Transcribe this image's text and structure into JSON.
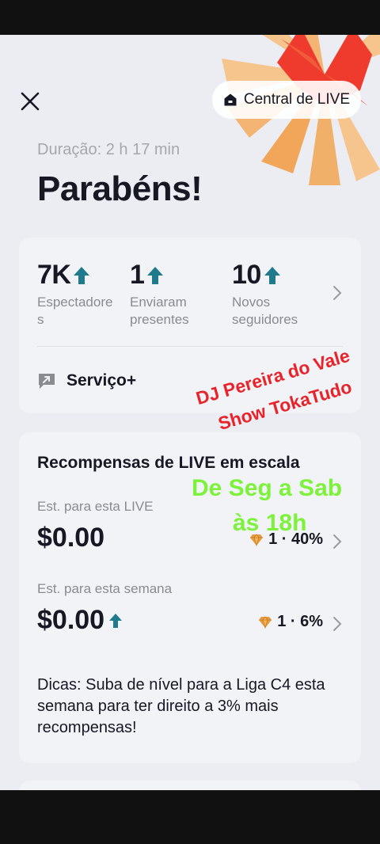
{
  "header": {
    "close_icon": "close-icon",
    "live_center_label": "Central de LIVE",
    "live_center_icon": "home-icon"
  },
  "summary": {
    "duration": "Duração: 2 h 17 min",
    "title": "Parabéns!"
  },
  "stats": [
    {
      "value": "7K",
      "label_line1": "Espectadore",
      "label_line2": "s",
      "trend": "up"
    },
    {
      "value": "1",
      "label_line1": "Enviaram",
      "label_line2": "presentes",
      "trend": "up"
    },
    {
      "value": "10",
      "label_line1": "Novos",
      "label_line2": "seguidores",
      "trend": "up"
    }
  ],
  "service": {
    "label": "Serviço+",
    "icon": "chat-arrow-icon"
  },
  "rewards": {
    "title": "Recompensas de LIVE em escala",
    "this_live": {
      "label": "Est. para esta LIVE",
      "amount": "$0.00",
      "stat": "1 · 40%"
    },
    "this_week": {
      "label": "Est. para esta semana",
      "amount": "$0.00",
      "stat": "1 · 6%"
    },
    "tips": "Dicas: Suba de nível para a Liga C4 esta semana para ter direito a 3% mais recompensas!"
  },
  "overlay": {
    "red_line1": "DJ Pereira do Vale",
    "red_line2": "Show TokaTudo",
    "green_line1": "De Seg a Sab",
    "green_line2": "às 18h"
  },
  "colors": {
    "accent_teal": "#1f7a8c",
    "overlay_red": "#e8232a",
    "overlay_green": "#7cf23a",
    "diamond": "#e89a3c"
  }
}
